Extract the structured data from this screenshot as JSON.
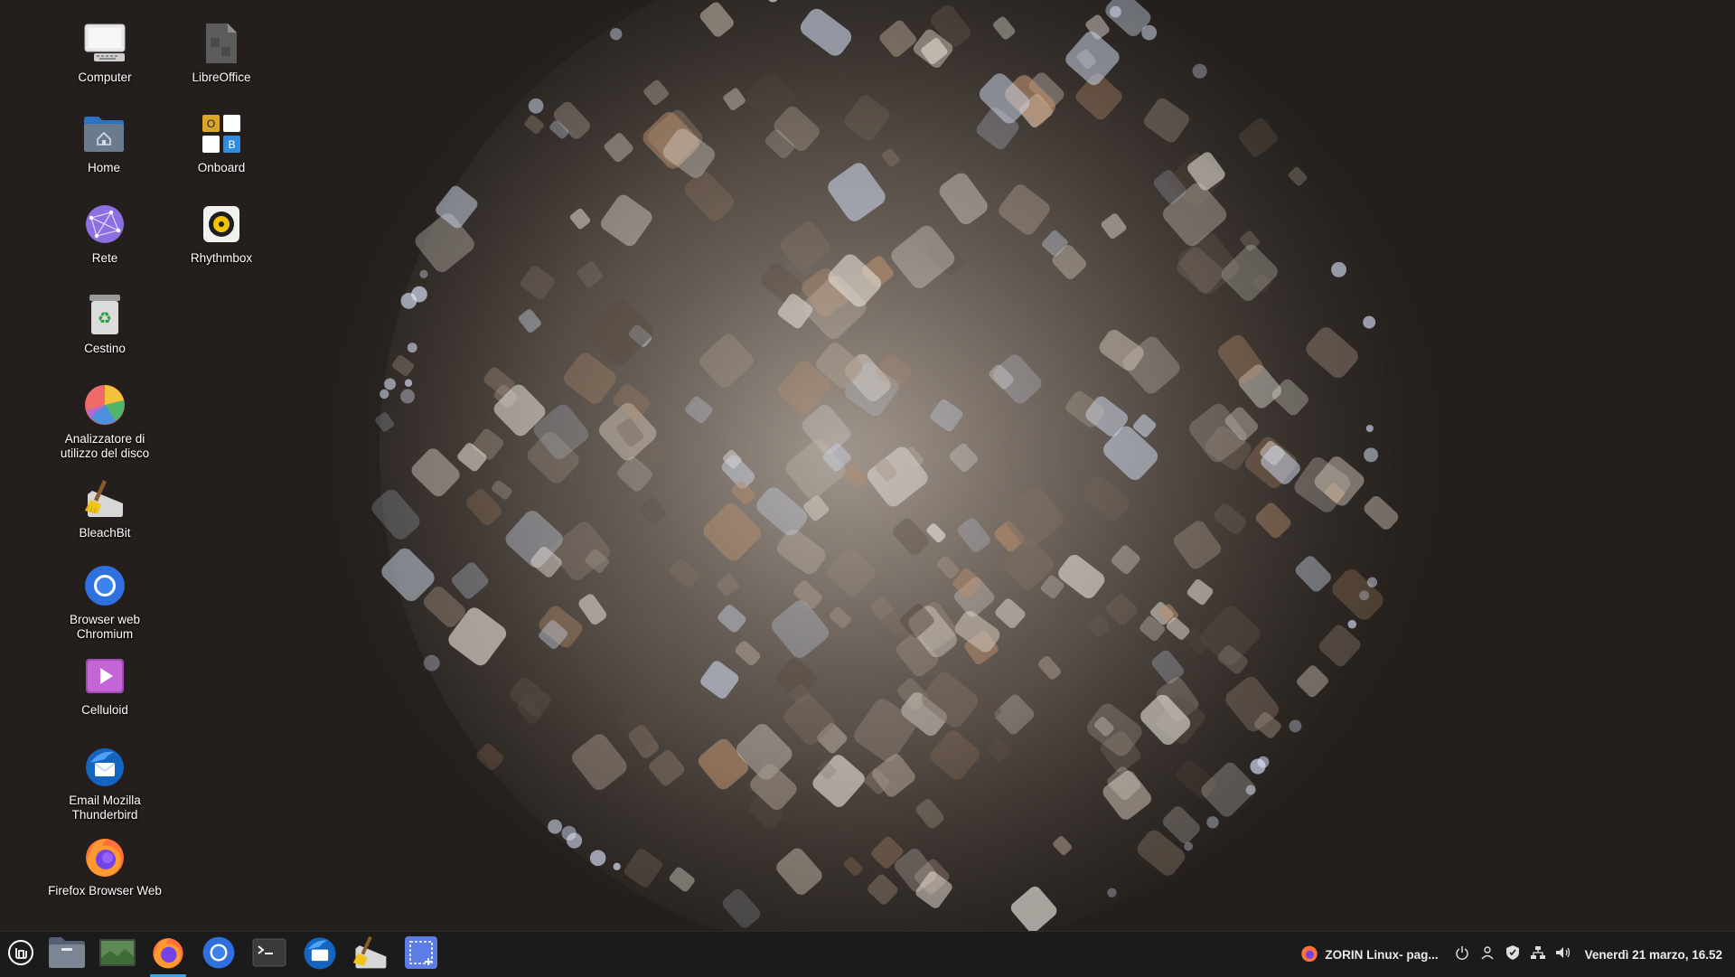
{
  "desktop": {
    "icons": [
      {
        "label": "Computer",
        "icon": "computer-icon"
      },
      {
        "label": "LibreOffice",
        "icon": "libreoffice-icon"
      },
      {
        "label": "Home",
        "icon": "home-folder-icon"
      },
      {
        "label": "Onboard",
        "icon": "onboard-keyboard-icon"
      },
      {
        "label": "Rete",
        "icon": "network-icon"
      },
      {
        "label": "Rhythmbox",
        "icon": "rhythmbox-icon"
      },
      {
        "label": "Cestino",
        "icon": "trash-icon"
      },
      {
        "label": "Analizzatore di utilizzo del disco",
        "icon": "disk-usage-analyzer-icon"
      },
      {
        "label": "BleachBit",
        "icon": "bleachbit-icon"
      },
      {
        "label": "Browser web Chromium",
        "icon": "chromium-icon"
      },
      {
        "label": "Celluloid",
        "icon": "celluloid-icon"
      },
      {
        "label": "Email Mozilla Thunderbird",
        "icon": "thunderbird-icon"
      },
      {
        "label": "Firefox Browser Web",
        "icon": "firefox-icon"
      }
    ],
    "onboard_letters": [
      "O",
      "B"
    ]
  },
  "taskbar": {
    "menu_icon": "linux-mint-menu-icon",
    "pinned": [
      {
        "icon": "file-manager-icon",
        "active": false
      },
      {
        "icon": "desktop-show-icon",
        "active": false
      },
      {
        "icon": "firefox-icon",
        "active": true
      },
      {
        "icon": "chromium-icon",
        "active": false
      },
      {
        "icon": "terminal-icon",
        "active": false
      },
      {
        "icon": "thunderbird-icon",
        "active": false
      },
      {
        "icon": "bleachbit-icon",
        "active": false
      },
      {
        "icon": "screenshot-icon",
        "active": false
      }
    ],
    "window_title": "ZORIN Linux- pag...",
    "tray": [
      "power-icon",
      "user-icon",
      "shield-icon",
      "network-icon",
      "volume-icon"
    ],
    "clock": "Venerdì 21 marzo, 16.52"
  },
  "colors": {
    "taskbar_bg": "#1b1b1b",
    "accent": "#3aa3e8"
  }
}
